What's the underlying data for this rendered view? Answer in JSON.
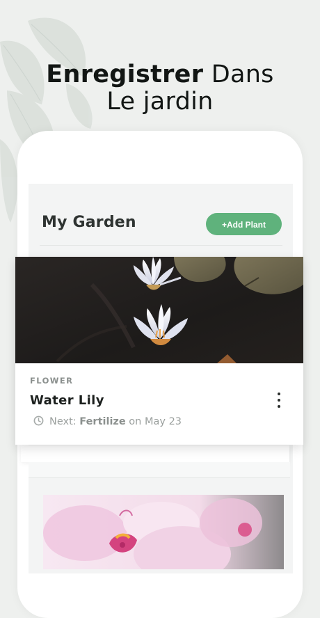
{
  "headline": {
    "bold": "Enregistrer",
    "light": "Dans",
    "line2": "Le jardin"
  },
  "garden": {
    "title": "My Garden",
    "add_button": "+Add Plant"
  },
  "plants": [
    {
      "category": "FLOWER",
      "name": "Water Lily",
      "next_prefix": "Next: ",
      "next_task": "Fertilize",
      "next_suffix": " on May 23",
      "menu_icon": "more-vertical-icon",
      "time_icon": "clock-icon"
    }
  ],
  "colors": {
    "accent": "#5fb27c",
    "background": "#eef0ee",
    "screen": "#f3f4f4"
  }
}
